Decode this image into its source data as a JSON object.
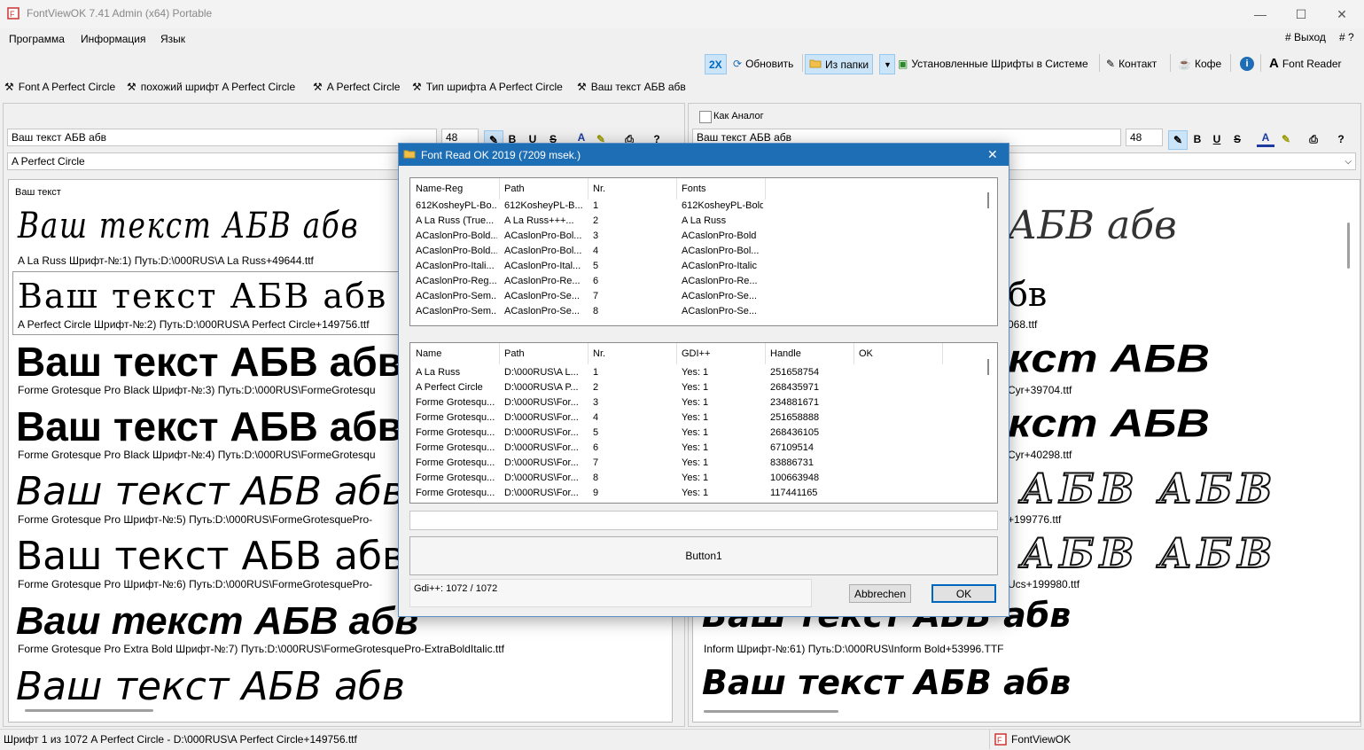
{
  "window": {
    "title": "FontViewOK 7.41 Admin (x64) Portable",
    "controls": {
      "minimize": "—",
      "maximize": "☐",
      "close": "✕"
    }
  },
  "menu": {
    "items": [
      "Программа",
      "Информация",
      "Язык"
    ],
    "right": [
      "# Выход",
      "# ?"
    ]
  },
  "toolbar": {
    "zoom_label": "2X",
    "refresh_label": "Обновить",
    "from_folder_label": "Из папки",
    "installed_label": "Установленные Шрифты в Системе",
    "contact_label": "Контакт",
    "coffee_label": "Кофе",
    "info_label": "i",
    "font_reader_label": "Font Reader"
  },
  "tabs": [
    {
      "label": "Font A Perfect Circle"
    },
    {
      "label": "похожий шрифт  A Perfect Circle"
    },
    {
      "label": "A Perfect Circle"
    },
    {
      "label": "Тип шрифта  A Perfect Circle"
    },
    {
      "label": "Ваш текст АБВ абв"
    }
  ],
  "left_panel": {
    "text_input": "Ваш текст АБВ абв",
    "size": "48",
    "font_select": "A Perfect Circle",
    "preview_label": "Ваш текст",
    "format_buttons": [
      "B",
      "U",
      "S",
      "A",
      "?"
    ],
    "samples": [
      {
        "text": "Ваш текст АБВ абв",
        "caption": "A La Russ Шрифт-№:1) Путь:D:\\000RUS\\A La Russ+49644.ttf"
      },
      {
        "text": "Ваш текст АБВ абв",
        "caption": "A Perfect Circle Шрифт-№:2) Путь:D:\\000RUS\\A Perfect Circle+149756.ttf"
      },
      {
        "text": "Ваш текст АБВ абв",
        "caption": "Forme Grotesque Pro Black Шрифт-№:3) Путь:D:\\000RUS\\FormeGrotesqu"
      },
      {
        "text": "Ваш текст АБВ абв",
        "caption": "Forme Grotesque Pro Black Шрифт-№:4) Путь:D:\\000RUS\\FormeGrotesqu"
      },
      {
        "text": "Ваш текст АБВ абв",
        "caption": "Forme Grotesque Pro Шрифт-№:5) Путь:D:\\000RUS\\FormeGrotesquePro-"
      },
      {
        "text": "Ваш текст АБВ абв",
        "caption": "Forme Grotesque Pro Шрифт-№:6) Путь:D:\\000RUS\\FormeGrotesquePro-"
      },
      {
        "text": "Ваш текст АБВ абв",
        "caption": "Forme Grotesque Pro Extra Bold Шрифт-№:7) Путь:D:\\000RUS\\FormeGrotesquePro-ExtraBoldItalic.ttf"
      },
      {
        "text": "Ваш текст АБВ абв",
        "caption": ""
      }
    ]
  },
  "right_panel": {
    "checkbox_label": "Как Аналог",
    "text_input": "Ваш текст АБВ абв",
    "size": "48",
    "format_buttons": [
      "B",
      "U",
      "S",
      "A",
      "?"
    ],
    "samples": [
      {
        "text": "АБВ абв",
        "caption": ""
      },
      {
        "text": "бв",
        "caption": "068.ttf"
      },
      {
        "text": "кст АБВ",
        "caption": "Cyr+39704.ttf"
      },
      {
        "text": "кст АБВ",
        "caption": "Cyr+40298.ttf"
      },
      {
        "text": "АБВ АБВ",
        "caption": "+199776.ttf"
      },
      {
        "text": "АБВ АБВ",
        "caption": "Ucs+199980.ttf"
      },
      {
        "text": "Ваш текст АБВ абв",
        "caption": "Inform Шрифт-№:61) Путь:D:\\000RUS\\Inform Bold+53996.TTF"
      },
      {
        "text": "Ваш текст АБВ абв",
        "caption": ""
      }
    ]
  },
  "dialog": {
    "title": "Font Read OK 2019 (7209 msek.)",
    "close": "✕",
    "grid1": {
      "headers": [
        "Name-Reg",
        "Path",
        "Nr.",
        "Fonts"
      ],
      "rows": [
        [
          "612KosheyPL-Bo...",
          "612KosheyPL-B...",
          "1",
          "612KosheyPL-Bold"
        ],
        [
          "A La Russ (True...",
          "A La Russ+++...",
          "2",
          "A La Russ"
        ],
        [
          "ACaslonPro-Bold...",
          "ACaslonPro-Bol...",
          "3",
          "ACaslonPro-Bold"
        ],
        [
          "ACaslonPro-Bold...",
          "ACaslonPro-Bol...",
          "4",
          "ACaslonPro-Bol..."
        ],
        [
          "ACaslonPro-Itali...",
          "ACaslonPro-Ital...",
          "5",
          "ACaslonPro-Italic"
        ],
        [
          "ACaslonPro-Reg...",
          "ACaslonPro-Re...",
          "6",
          "ACaslonPro-Re..."
        ],
        [
          "ACaslonPro-Sem...",
          "ACaslonPro-Se...",
          "7",
          "ACaslonPro-Se..."
        ],
        [
          "ACaslonPro-Sem...",
          "ACaslonPro-Se...",
          "8",
          "ACaslonPro-Se..."
        ]
      ]
    },
    "grid2": {
      "headers": [
        "Name",
        "Path",
        "Nr.",
        "GDI++",
        "Handle",
        "OK"
      ],
      "rows": [
        [
          "A La Russ",
          "D:\\000RUS\\A L...",
          "1",
          "Yes: 1",
          "251658754",
          ""
        ],
        [
          "A Perfect Circle",
          "D:\\000RUS\\A P...",
          "2",
          "Yes: 1",
          "268435971",
          ""
        ],
        [
          "Forme Grotesqu...",
          "D:\\000RUS\\For...",
          "3",
          "Yes: 1",
          "234881671",
          ""
        ],
        [
          "Forme Grotesqu...",
          "D:\\000RUS\\For...",
          "4",
          "Yes: 1",
          "251658888",
          ""
        ],
        [
          "Forme Grotesqu...",
          "D:\\000RUS\\For...",
          "5",
          "Yes: 1",
          "268436105",
          ""
        ],
        [
          "Forme Grotesqu...",
          "D:\\000RUS\\For...",
          "6",
          "Yes: 1",
          "67109514",
          ""
        ],
        [
          "Forme Grotesqu...",
          "D:\\000RUS\\For...",
          "7",
          "Yes: 1",
          "83886731",
          ""
        ],
        [
          "Forme Grotesqu...",
          "D:\\000RUS\\For...",
          "8",
          "Yes: 1",
          "100663948",
          ""
        ],
        [
          "Forme Grotesqu...",
          "D:\\000RUS\\For...",
          "9",
          "Yes: 1",
          "117441165",
          ""
        ]
      ]
    },
    "input_value": "",
    "button1_label": "Button1",
    "gdi_status": "Gdi++: 1072 / 1072",
    "cancel_label": "Abbrechen",
    "ok_label": "OK"
  },
  "statusbar": {
    "text": "Шрифт 1 из 1072 A Perfect Circle - D:\\000RUS\\A Perfect Circle+149756.ttf",
    "app_label": "FontViewOK"
  },
  "colors": {
    "accent": "#1e6eb5",
    "button_highlight": "#cce4f7",
    "link_blue": "#0067c0"
  }
}
